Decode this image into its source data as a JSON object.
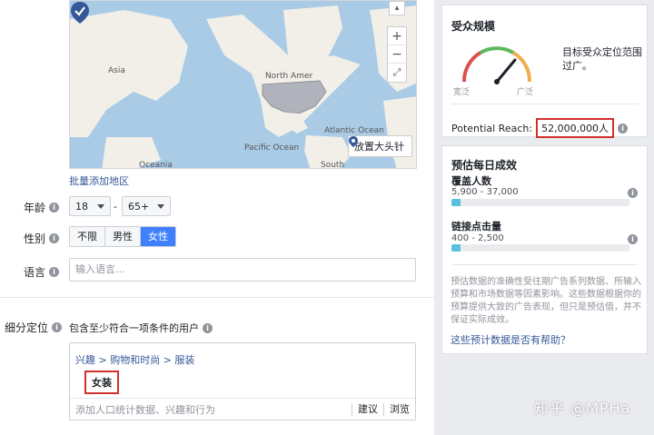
{
  "map": {
    "labels": {
      "asia": "Asia",
      "north_america": "North Amer",
      "pacific_ocean": "Pacific Ocean",
      "atlantic_ocean": "Atlantic Ocean",
      "oceania": "Oceania",
      "south": "South"
    },
    "pin_button_label": "放置大头针"
  },
  "batch_add_link": "批量添加地区",
  "age": {
    "label": "年龄",
    "min": "18",
    "dash": "-",
    "max": "65+"
  },
  "gender": {
    "label": "性别",
    "options": [
      "不限",
      "男性",
      "女性"
    ],
    "selected": "女性"
  },
  "language": {
    "label": "语言",
    "placeholder": "输入语言..."
  },
  "detailed_targeting": {
    "label": "细分定位",
    "description": "包含至少符合一项条件的用户",
    "breadcrumb": "兴趣 > 购物和时尚 > 服装",
    "tag": "女装",
    "input_placeholder": "添加人口统计数据、兴趣和行为",
    "suggest_label": "建议",
    "browse_label": "浏览"
  },
  "audience_size": {
    "title": "受众规模",
    "gauge_left": "宽泛",
    "gauge_right": "广泛",
    "description": "目标受众定位范围过广。",
    "reach_label": "Potential Reach:",
    "reach_value": "52,000,000人"
  },
  "daily_results": {
    "title": "预估每日成效",
    "reach_title": "覆盖人数",
    "reach_range": "5,900 - 37,000",
    "reach_fill": 0.05,
    "clicks_title": "链接点击量",
    "clicks_range": "400 - 2,500",
    "clicks_fill": 0.05,
    "note": "预估数据的准确性受往期广告系列数据、所输入预算和市场数据等因素影响。这些数据根据你的预算提供大致的广告表现，但只是预估值，并不保证实际成效。",
    "help_link": "这些预计数据是否有帮助？"
  },
  "watermark": "知乎 @MPHa",
  "colors": {
    "accent": "#4080ff",
    "link": "#365899",
    "highlight": "#d0312d",
    "bar_fill": "#5bc0de"
  }
}
